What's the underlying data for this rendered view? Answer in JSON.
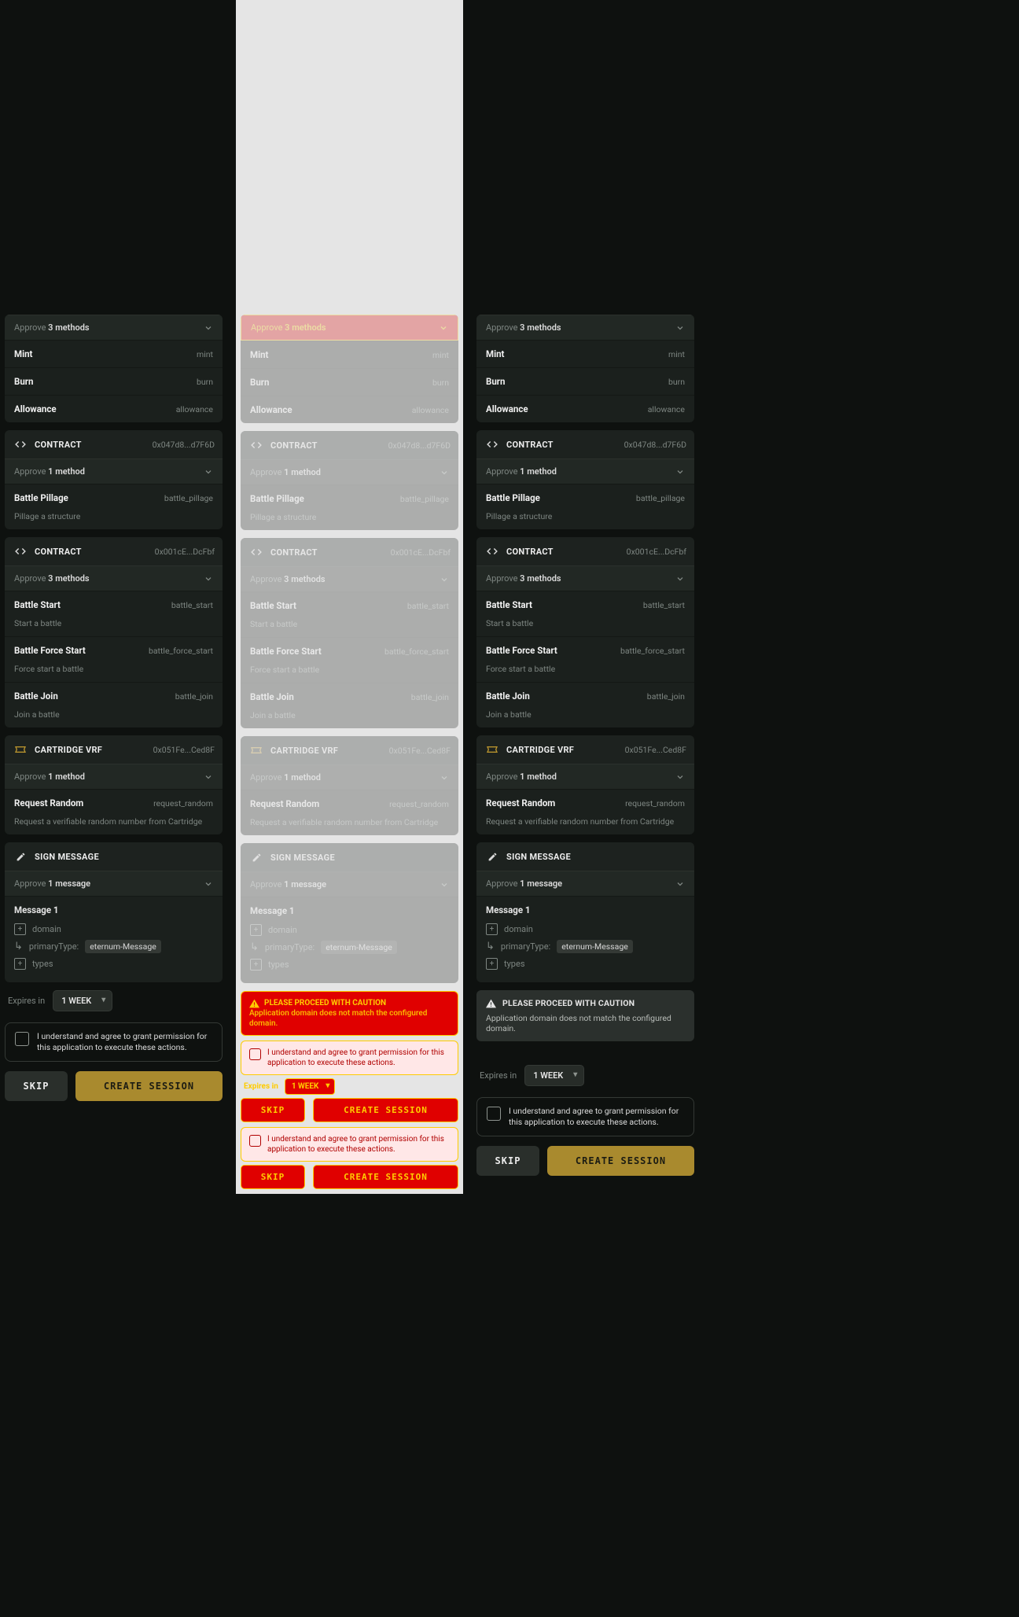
{
  "approveWord": "Approve",
  "methods": {
    "one": "1 method",
    "three": "3 methods",
    "oneMsg": "1 message"
  },
  "contract0": {
    "methods": [
      {
        "name": "Mint",
        "selector": "mint"
      },
      {
        "name": "Burn",
        "selector": "burn"
      },
      {
        "name": "Allowance",
        "selector": "allowance"
      }
    ]
  },
  "contract1": {
    "title": "CONTRACT",
    "addr": "0x047d8...d7F6D",
    "methods": [
      {
        "name": "Battle Pillage",
        "selector": "battle_pillage",
        "desc": "Pillage a structure"
      }
    ]
  },
  "contract2": {
    "title": "CONTRACT",
    "addr": "0x001cE...DcFbf",
    "methods": [
      {
        "name": "Battle Start",
        "selector": "battle_start",
        "desc": "Start a battle"
      },
      {
        "name": "Battle Force Start",
        "selector": "battle_force_start",
        "desc": "Force start a battle"
      },
      {
        "name": "Battle Join",
        "selector": "battle_join",
        "desc": "Join a battle"
      }
    ]
  },
  "vrf": {
    "title": "CARTRIDGE VRF",
    "addr": "0x051Fe...Ced8F",
    "methods": [
      {
        "name": "Request Random",
        "selector": "request_random",
        "desc": "Request a verifiable random number from Cartridge"
      }
    ]
  },
  "sign": {
    "title": "SIGN MESSAGE",
    "msgTitle": "Message 1",
    "rows": {
      "domain": "domain",
      "primaryType": "primaryType:",
      "primaryValue": "eternum-Message",
      "types": "types"
    }
  },
  "warning": {
    "title": "PLEASE PROCEED WITH CAUTION",
    "desc": "Application domain does not match the configured domain."
  },
  "expires": {
    "label": "Expires in",
    "value": "1 WEEK"
  },
  "agree": "I understand and agree to grant permission for this application to execute these actions.",
  "buttons": {
    "skip": "SKIP",
    "create": "CREATE SESSION"
  }
}
